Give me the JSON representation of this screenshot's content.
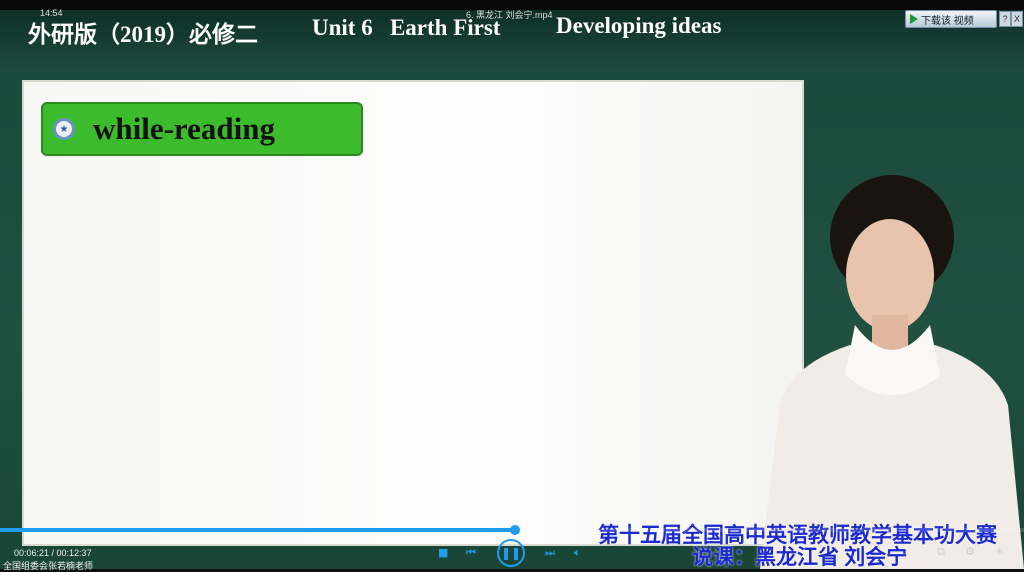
{
  "player": {
    "clock": "14:54",
    "filename": "6. 黑龙江 刘会宁.mp4",
    "download_label": "下载该 视频",
    "help_label": "?",
    "close_label": "X",
    "current_time": "00:06:21",
    "duration": "00:12:37",
    "time_display": "00:06:21 / 00:12:37",
    "progress_fraction": 0.503,
    "uploader": "全国组委会张若楠老师",
    "accent_color": "#1f9cf0"
  },
  "video": {
    "title_book": "外研版（2019）必修二",
    "title_unit": "Unit 6   Earth First",
    "title_section": "Developing ideas",
    "slide_heading": "while-reading",
    "caption_line1": "第十五届全国高中英语教师教学基本功大赛",
    "caption_line2": "说课：黑龙江省 刘会宁"
  }
}
